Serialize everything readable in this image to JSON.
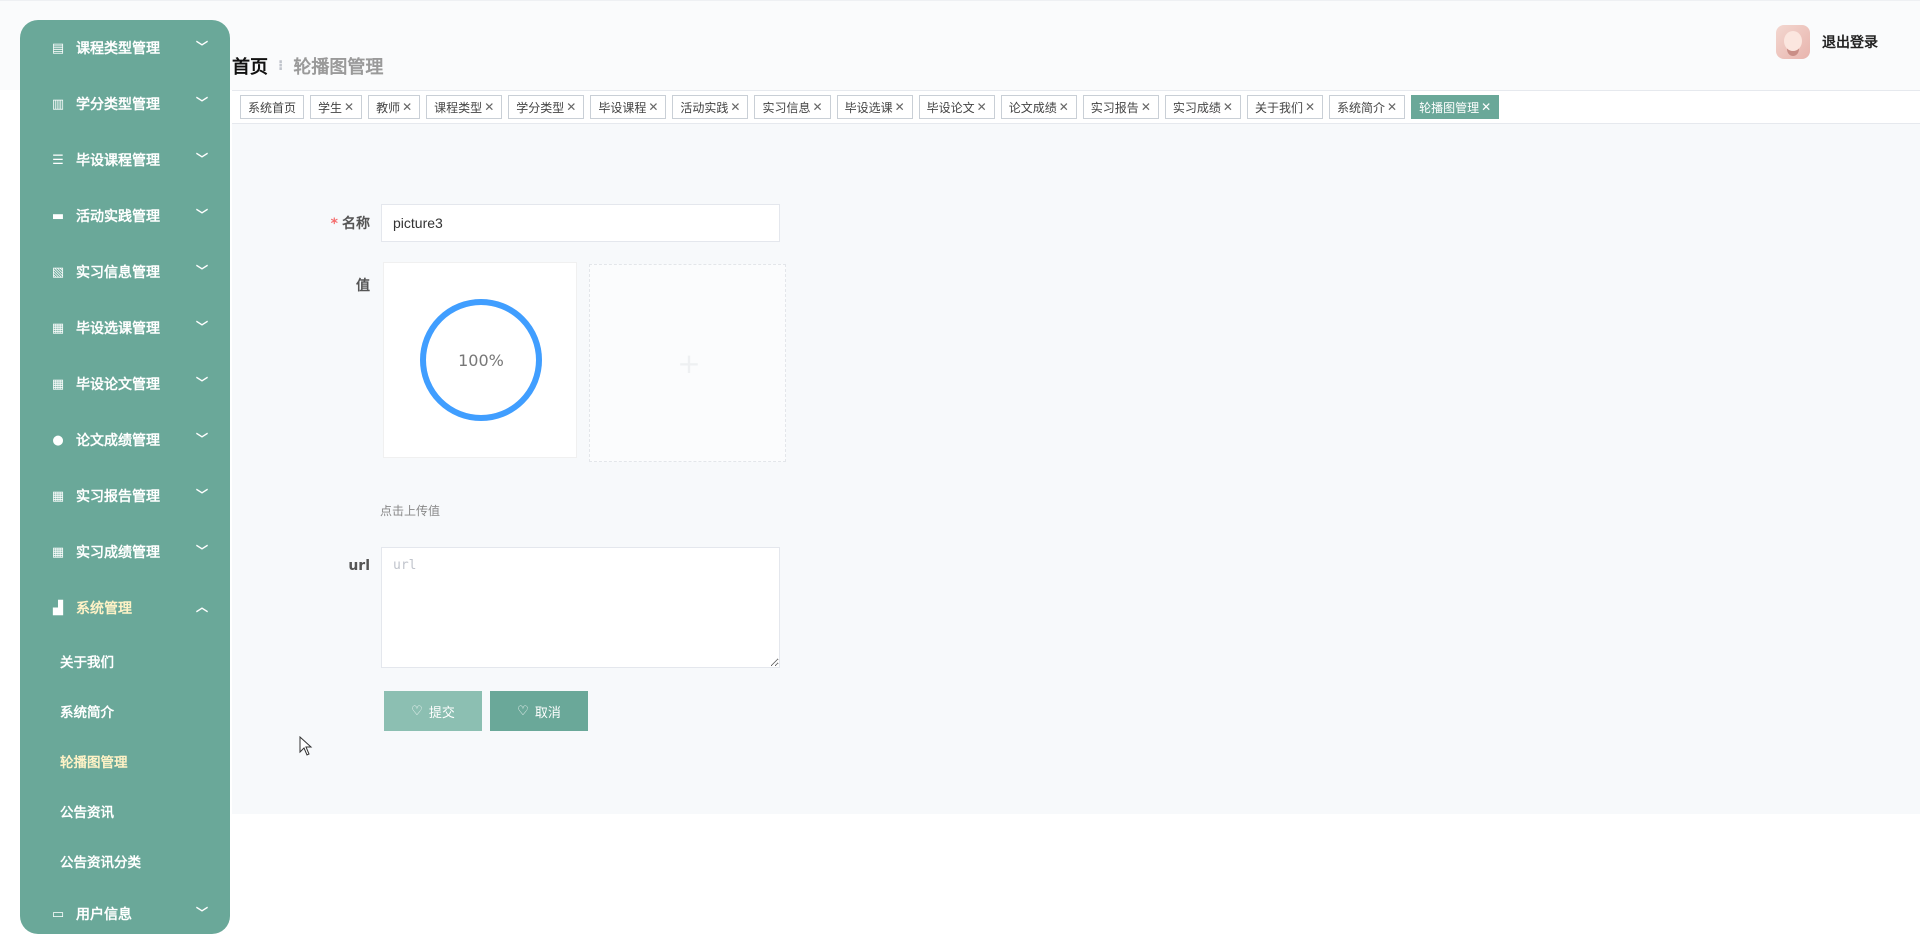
{
  "header": {
    "logout_label": "退出登录"
  },
  "breadcrumb": {
    "home": "首页",
    "separator": "⁝",
    "current": "轮播图管理"
  },
  "tags": [
    {
      "label": "系统首页",
      "closable": false,
      "active": false
    },
    {
      "label": "学生",
      "closable": true,
      "active": false
    },
    {
      "label": "教师",
      "closable": true,
      "active": false
    },
    {
      "label": "课程类型",
      "closable": true,
      "active": false
    },
    {
      "label": "学分类型",
      "closable": true,
      "active": false
    },
    {
      "label": "毕设课程",
      "closable": true,
      "active": false
    },
    {
      "label": "活动实践",
      "closable": true,
      "active": false
    },
    {
      "label": "实习信息",
      "closable": true,
      "active": false
    },
    {
      "label": "毕设选课",
      "closable": true,
      "active": false
    },
    {
      "label": "毕设论文",
      "closable": true,
      "active": false
    },
    {
      "label": "论文成绩",
      "closable": true,
      "active": false
    },
    {
      "label": "实习报告",
      "closable": true,
      "active": false
    },
    {
      "label": "实习成绩",
      "closable": true,
      "active": false
    },
    {
      "label": "关于我们",
      "closable": true,
      "active": false
    },
    {
      "label": "系统简介",
      "closable": true,
      "active": false
    },
    {
      "label": "轮播图管理",
      "closable": true,
      "active": true
    }
  ],
  "tag_close_glyph": "✕",
  "sidebar": {
    "items": [
      {
        "label": "课程类型管理",
        "icon": "clipboard-icon",
        "glyph": "▤"
      },
      {
        "label": "学分类型管理",
        "icon": "book-icon",
        "glyph": "▥"
      },
      {
        "label": "毕设课程管理",
        "icon": "list-icon",
        "glyph": "☰"
      },
      {
        "label": "活动实践管理",
        "icon": "monitor-icon",
        "glyph": "▬"
      },
      {
        "label": "实习信息管理",
        "icon": "clipboard-check-icon",
        "glyph": "▧"
      },
      {
        "label": "毕设选课管理",
        "icon": "grid-icon",
        "glyph": "▦"
      },
      {
        "label": "毕设论文管理",
        "icon": "grid-icon",
        "glyph": "▦"
      },
      {
        "label": "论文成绩管理",
        "icon": "location-pin-icon",
        "glyph": "●"
      },
      {
        "label": "实习报告管理",
        "icon": "table-icon",
        "glyph": "▦"
      },
      {
        "label": "实习成绩管理",
        "icon": "grid-icon",
        "glyph": "▦"
      }
    ],
    "system_menu": {
      "label": "系统管理",
      "icon": "bar-chart-icon",
      "glyph": "▟"
    },
    "system_sub_items": [
      {
        "label": "关于我们",
        "active": false
      },
      {
        "label": "系统简介",
        "active": false
      },
      {
        "label": "轮播图管理",
        "active": true
      },
      {
        "label": "公告资讯",
        "active": false
      },
      {
        "label": "公告资讯分类",
        "active": false
      }
    ],
    "user_menu": {
      "label": "用户信息",
      "icon": "id-card-icon",
      "glyph": "▭"
    },
    "chevron_down": "﹀",
    "chevron_up": "︿"
  },
  "form": {
    "name_label": "名称",
    "name_required_mark": "*",
    "name_value": "picture3",
    "value_label": "值",
    "upload_progress": "100%",
    "upload_progress_percent": 100,
    "upload_hint": "点击上传值",
    "url_label": "url",
    "url_placeholder": "url",
    "url_value": "",
    "submit_label": "提交",
    "cancel_label": "取消",
    "button_icon": "♡"
  },
  "colors": {
    "accent": "#6aa899",
    "submit_button": "#8cbfb2",
    "active_text": "#fff2c6",
    "progress": "#409eff",
    "required": "#f56c6c"
  }
}
